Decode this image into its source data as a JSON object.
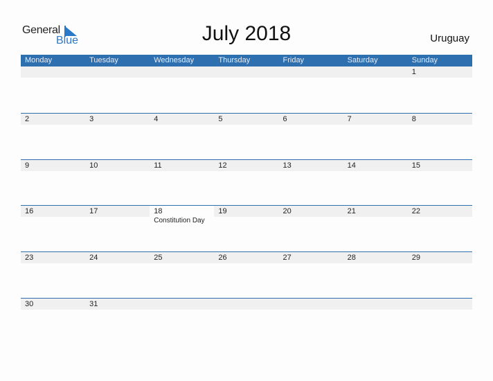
{
  "logo": {
    "general": "General",
    "blue": "Blue"
  },
  "title": "July 2018",
  "country": "Uruguay",
  "weekdays": [
    "Monday",
    "Tuesday",
    "Wednesday",
    "Thursday",
    "Friday",
    "Saturday",
    "Sunday"
  ],
  "weeks": [
    [
      "",
      "",
      "",
      "",
      "",
      "",
      "1"
    ],
    [
      "2",
      "3",
      "4",
      "5",
      "6",
      "7",
      "8"
    ],
    [
      "9",
      "10",
      "11",
      "12",
      "13",
      "14",
      "15"
    ],
    [
      "16",
      "17",
      "18",
      "19",
      "20",
      "21",
      "22"
    ],
    [
      "23",
      "24",
      "25",
      "26",
      "27",
      "28",
      "29"
    ],
    [
      "30",
      "31",
      "",
      "",
      "",
      "",
      ""
    ]
  ],
  "holidays": [
    {
      "week": 3,
      "day": 2,
      "name": "Constitution Day"
    }
  ],
  "colors": {
    "accent": "#2e6fb0",
    "logo_blue": "#2a78c8",
    "band": "#f0f0f0"
  }
}
